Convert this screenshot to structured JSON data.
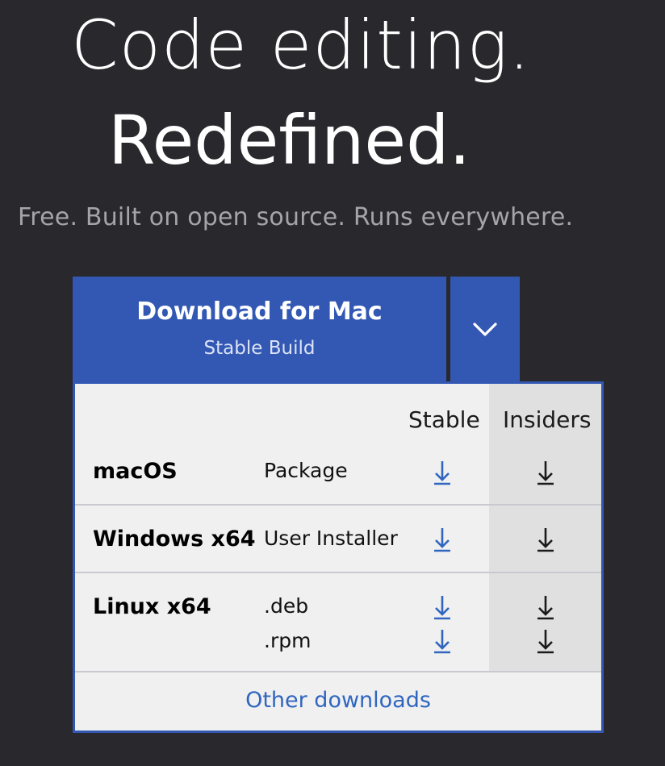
{
  "hero": {
    "line1": "Code editing.",
    "line2": "Redefined.",
    "tagline": "Free. Built on open source. Runs everywhere."
  },
  "download_button": {
    "title": "Download for Mac",
    "subtitle": "Stable Build",
    "toggle_icon": "chevron-down-icon",
    "color": "#3358b4"
  },
  "downloads_table": {
    "columns": [
      "Stable",
      "Insiders"
    ],
    "rows": [
      {
        "os": "macOS",
        "packages": [
          "Package"
        ]
      },
      {
        "os": "Windows x64",
        "packages": [
          "User Installer"
        ]
      },
      {
        "os": "Linux x64",
        "packages": [
          ".deb",
          ".rpm"
        ]
      }
    ],
    "stable_icon_color": "#3066c0",
    "insiders_icon_color": "#1b1b1b",
    "download_icon": "download-arrow-icon"
  },
  "other_downloads": "Other downloads"
}
